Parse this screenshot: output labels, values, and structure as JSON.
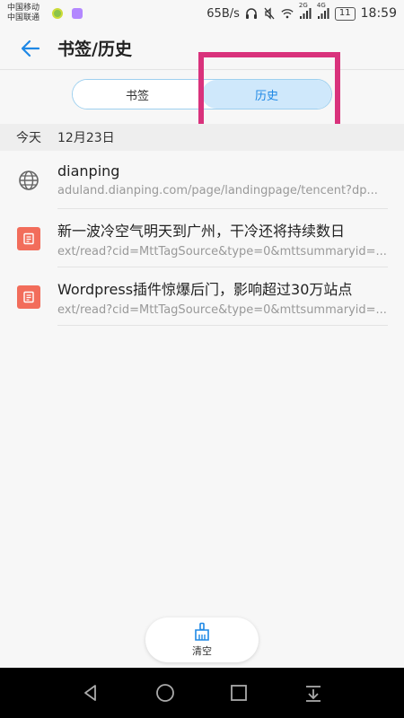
{
  "status_bar": {
    "carrier_1": "中国移动",
    "carrier_2": "中国联通",
    "net_speed": "65B/s",
    "net_2g": "2G",
    "net_4g": "4G",
    "battery": "11",
    "time": "18:59"
  },
  "header": {
    "title": "书签/历史"
  },
  "tabs": [
    {
      "label": "书签",
      "active": false
    },
    {
      "label": "历史",
      "active": true
    }
  ],
  "section": {
    "label": "今天",
    "date": "12月23日"
  },
  "history": [
    {
      "icon": "globe-icon",
      "title": "dianping",
      "url": "aduland.dianping.com/page/landingpage/tencent?dp..."
    },
    {
      "icon": "page-icon",
      "title": "新一波冷空气明天到广州，干冷还将持续数日",
      "url": "ext/read?cid=MttTagSource&type=0&mttsummaryid=..."
    },
    {
      "icon": "page-icon",
      "title": "Wordpress插件惊爆后门，影响超过30万站点",
      "url": "ext/read?cid=MttTagSource&type=0&mttsummaryid=..."
    }
  ],
  "clear_button": {
    "label": "清空"
  },
  "colors": {
    "accent": "#1e88e5",
    "highlight": "#d9327c",
    "page_icon": "#f26d5b"
  }
}
